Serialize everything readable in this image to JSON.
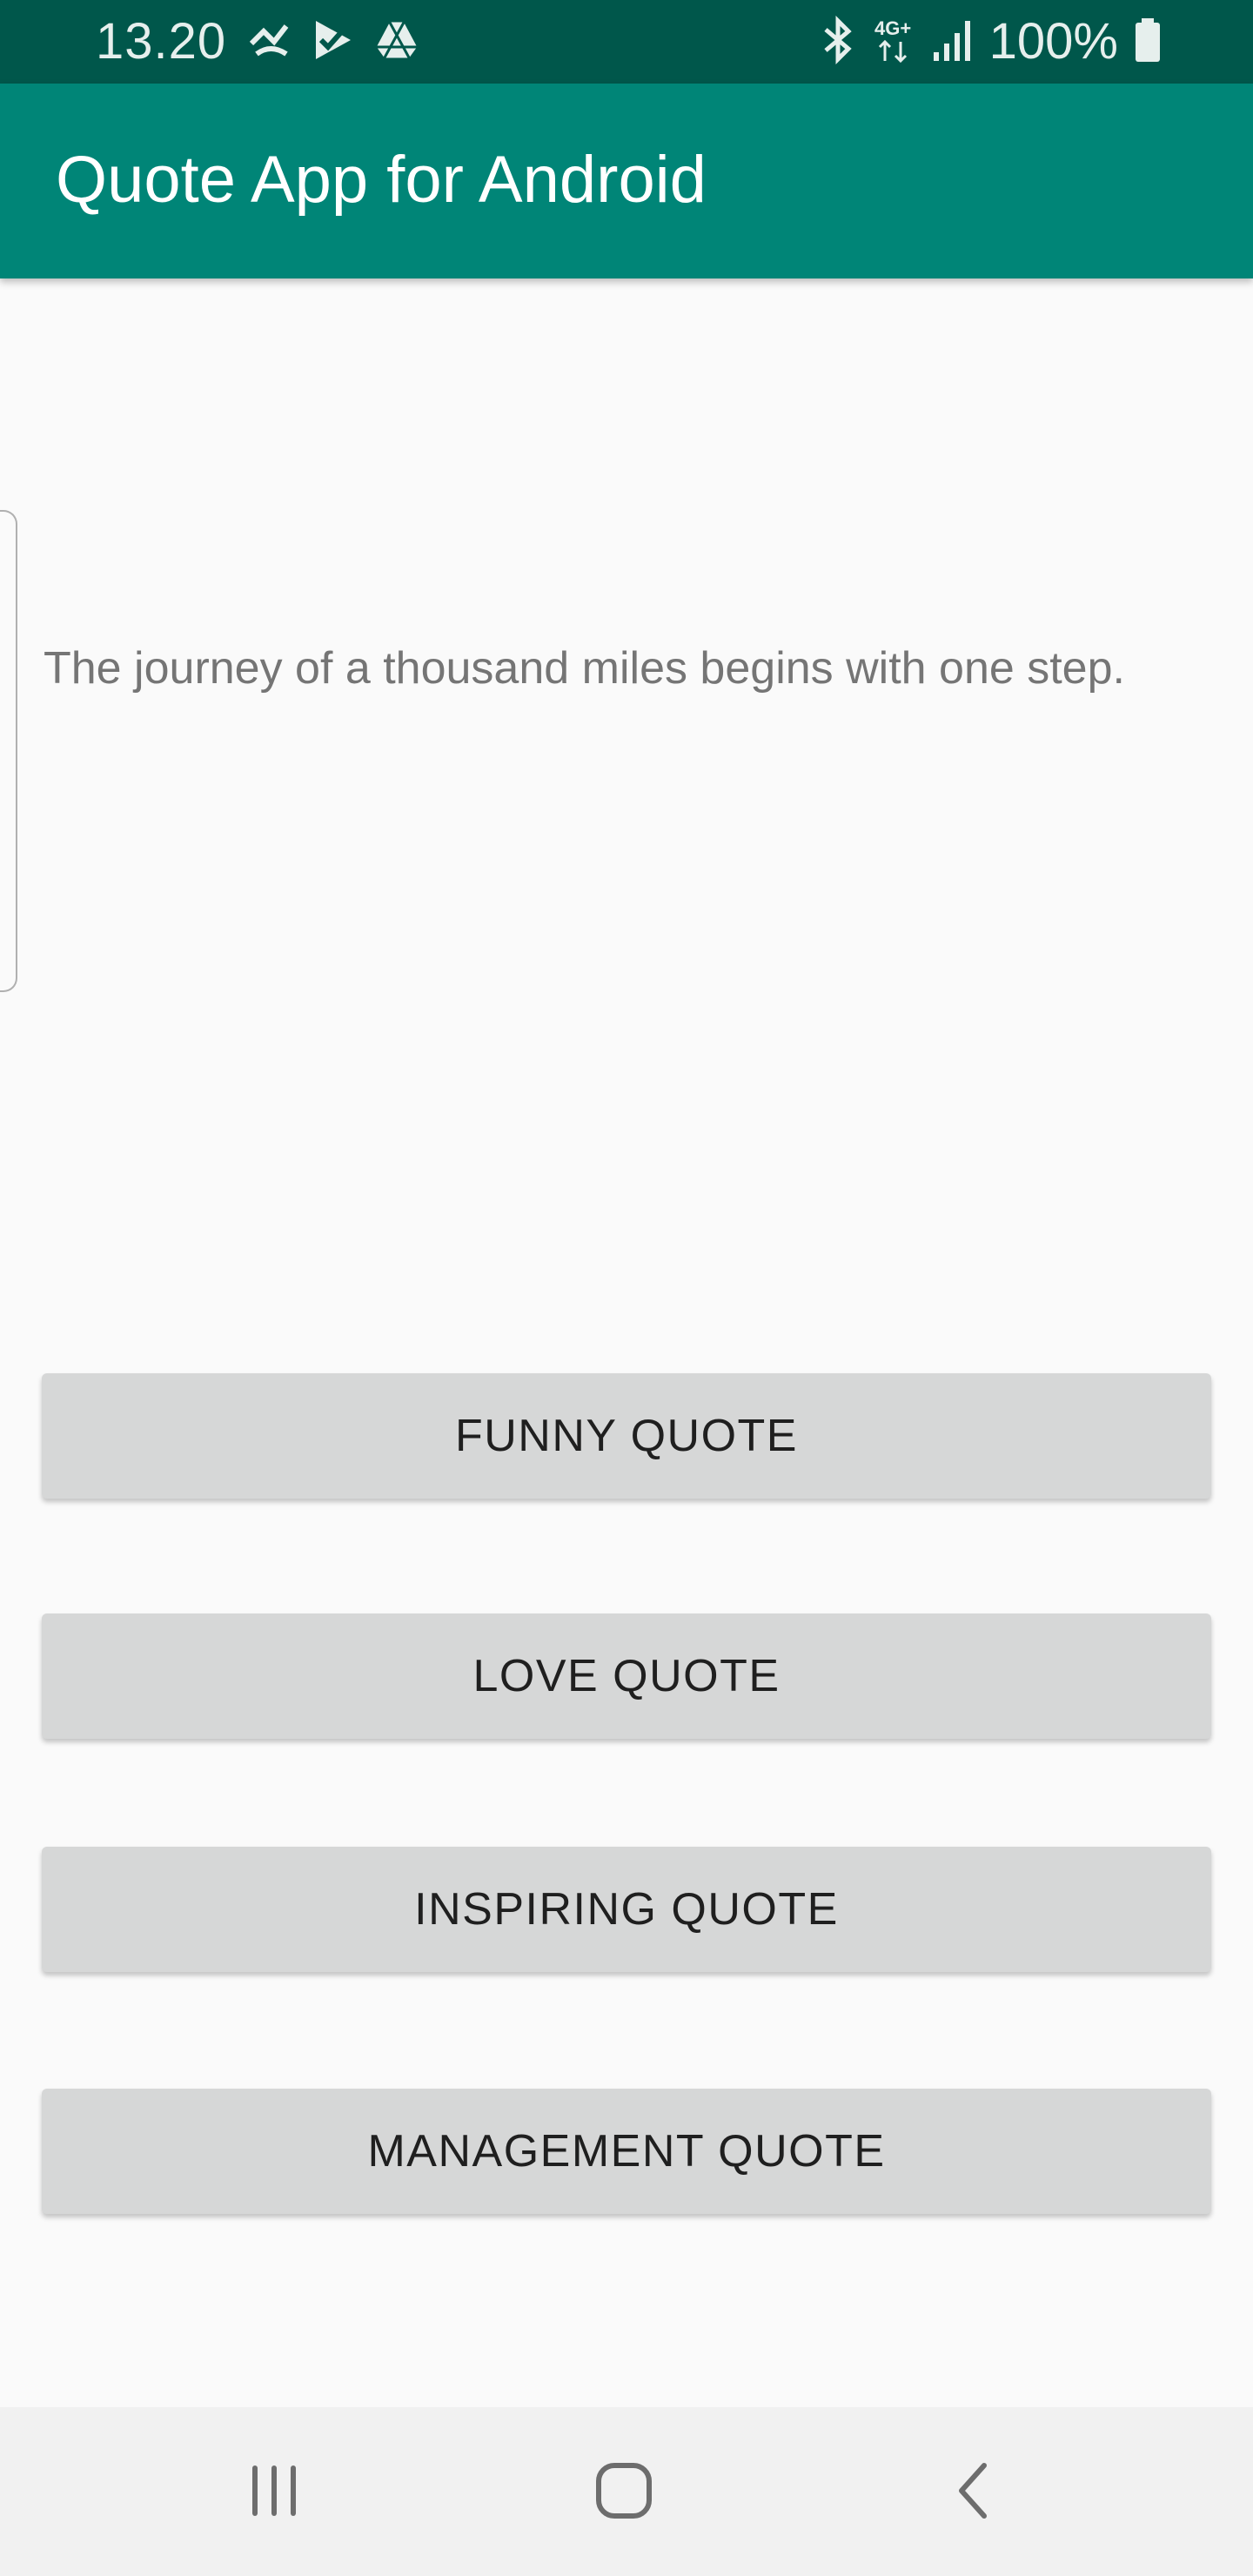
{
  "status_bar": {
    "time": "13.20",
    "battery": "100%",
    "network": "4G+",
    "icons_left": [
      "missed-call-icon",
      "play-check-icon",
      "drive-icon"
    ],
    "icons_right": [
      "bluetooth-icon",
      "network-4g-icon",
      "signal-icon",
      "battery-icon"
    ]
  },
  "app_bar": {
    "title": "Quote App for Android",
    "color": "#008577",
    "status_color": "#00574b"
  },
  "quote": {
    "text": "The journey of a thousand miles begins with one step."
  },
  "buttons": [
    {
      "label": "FUNNY QUOTE"
    },
    {
      "label": "LOVE QUOTE"
    },
    {
      "label": "INSPIRING QUOTE"
    },
    {
      "label": "MANAGEMENT QUOTE"
    }
  ],
  "nav_bar": {
    "items": [
      "recents-icon",
      "home-icon",
      "back-icon"
    ]
  }
}
